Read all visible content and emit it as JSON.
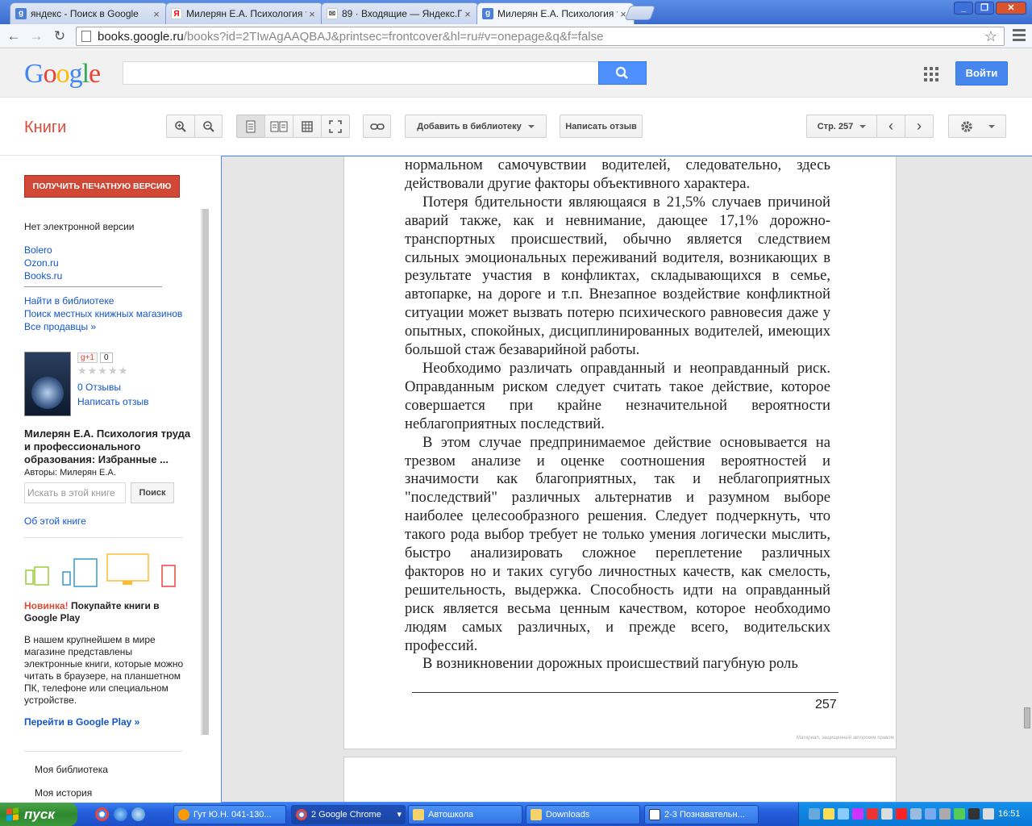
{
  "browser": {
    "tabs": [
      {
        "label": "яндекс - Поиск в Google",
        "icon": "g"
      },
      {
        "label": "Милерян Е.А. Психология т",
        "icon": "Я"
      },
      {
        "label": "89 · Входящие — Яндекс.П",
        "icon": "✉"
      },
      {
        "label": "Милерян Е.А. Психология т",
        "icon": "g"
      }
    ],
    "url_host": "books.google.ru",
    "url_path": "/books?id=2TIwAgAAQBAJ&printsec=frontcover&hl=ru#v=onepage&q&f=false"
  },
  "google": {
    "logo": "Google",
    "login_label": "Войти"
  },
  "books_toolbar": {
    "section_title": "Книги",
    "add_library": "Добавить в библиотеку",
    "write_review": "Написать отзыв",
    "page_label": "Стр. 257"
  },
  "sidebar": {
    "print_button": "ПОЛУЧИТЬ ПЕЧАТНУЮ ВЕРСИЮ",
    "no_ebook": "Нет электронной версии",
    "sellers": [
      "Bolero",
      "Ozon.ru",
      "Books.ru"
    ],
    "library_links": [
      "Найти в библиотеке",
      "Поиск местных книжных магазинов",
      "Все продавцы »"
    ],
    "gplus_label": "g+1",
    "gplus_count": "0",
    "reviews_count": "0 Отзывы",
    "write_review": "Написать отзыв",
    "book_title": "Милерян Е.А. Психология труда и профессионального образования: Избранные ...",
    "authors": "Авторы: Милерян Е.А.",
    "search_placeholder": "Искать в этой книге",
    "search_button": "Поиск",
    "about_link": "Об этой книге",
    "news_label": "Новинка!",
    "news_text": " Покупайте книги в Google Play",
    "news_desc": "В нашем крупнейшем в мире магазине представлены электронные книги, которые можно читать в браузере, на планшетном ПК, телефоне или специальном устройстве.",
    "gplay_link": "Перейти в Google Play »",
    "my_library": "Моя библиотека",
    "my_history": "Моя история"
  },
  "page": {
    "paragraphs": [
      "нормальном самочувствии водителей, следовательно, здесь действовали другие факторы объективного характера.",
      "Потеря бдительности являющаяся в 21,5% случаев причиной аварий также, как и невнимание, дающее 17,1% дорожно-транспортных происшествий, обычно является следствием сильных эмоциональных переживаний водителя, возникающих в результате участия в конфликтах, складывающихся в семье, автопарке, на дороге и т.п. Внезапное воздействие конфликтной ситуации может вызвать потерю психического равновесия даже у опытных, спокойных, дисциплинированных водителей, имеющих большой стаж безаварийной работы.",
      "Необходимо различать оправданный и неоправданный риск. Оправданным риском следует считать такое действие, которое совершается при крайне незначительной вероятности неблагоприятных последствий.",
      "В этом случае предпринимаемое действие основывается на трезвом анализе и оценке соотношения вероятностей и значимости как благоприятных, так и неблагоприятных \"последствий\" различных альтернатив и разумном выборе наиболее целесообразного решения. Следует подчеркнуть, что такого рода выбор требует не только умения логически мыслить, быстро анализировать сложное переплетение различных факторов но и таких сугубо личностных качеств, как смелость, решительность, выдержка. Способность идти на оправданный риск является весьма ценным качеством, которое необходимо людям самых различных, и прежде всего, водительских профессий.",
      "В возникновении дорожных происшествий пагубную роль"
    ],
    "page_number": "257",
    "copyright": "Материал, защищенный авторским правом"
  },
  "taskbar": {
    "start_label": "пуск",
    "items": [
      "Гут Ю.Н. 041-130...",
      "2 Google Chrome",
      "Автошкола",
      "Downloads",
      "2-3 Познавательн..."
    ],
    "clock": "16:51"
  }
}
